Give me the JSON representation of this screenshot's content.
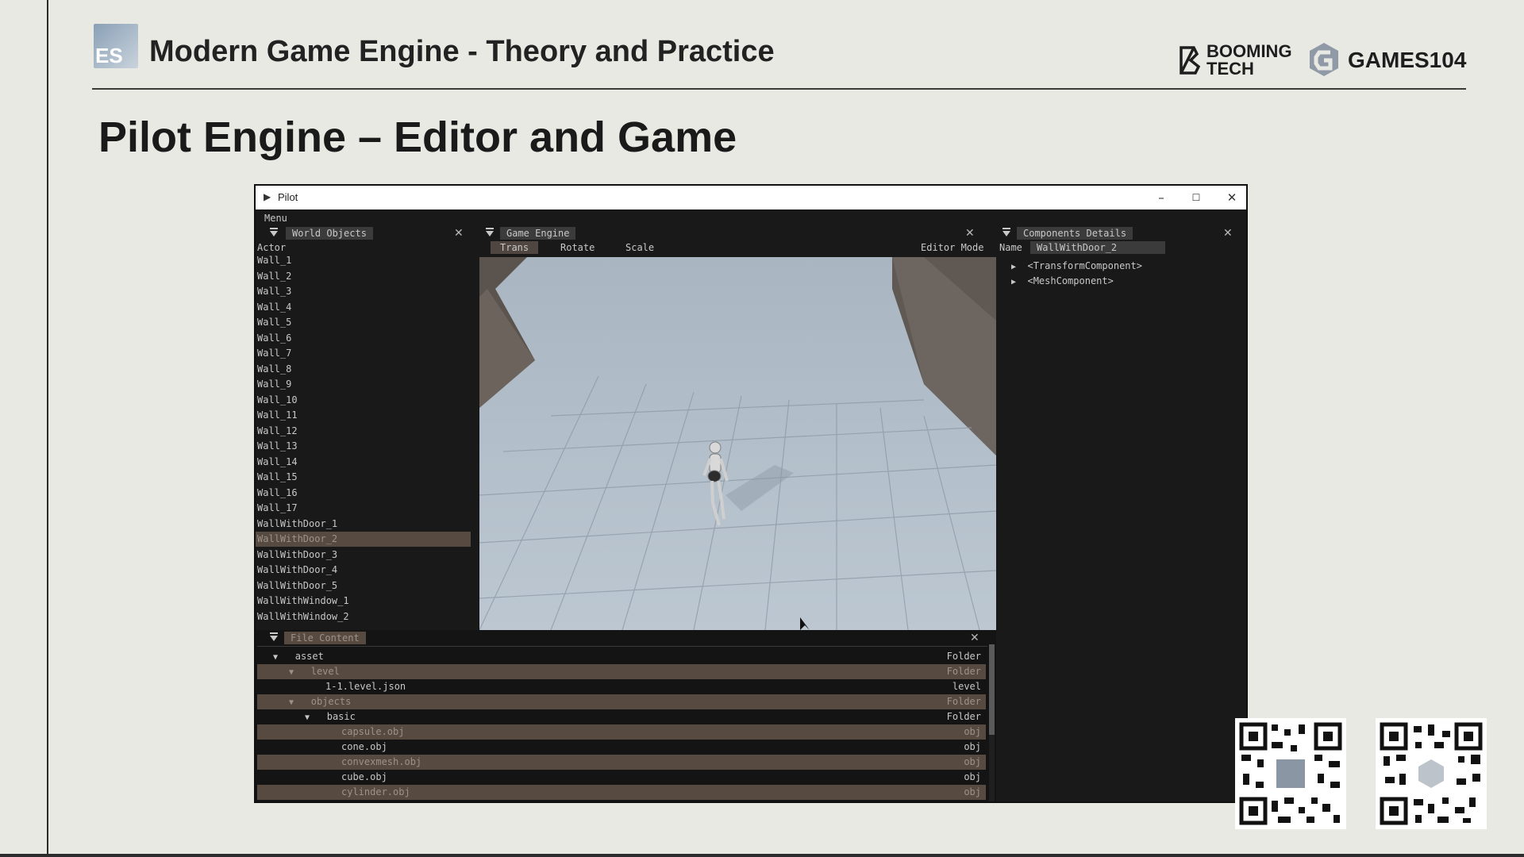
{
  "slide": {
    "course_logo_text": "ES",
    "course_title": "Modern Game Engine - Theory and Practice",
    "title": "Pilot Engine – Editor and Game",
    "logos": {
      "booming_line1": "BOOMING",
      "booming_line2": "TECH",
      "games": "GAMES104"
    }
  },
  "window": {
    "title": "Pilot",
    "controls": {
      "minimize": "–",
      "maximize": "☐",
      "close": "✕"
    },
    "menu": "Menu"
  },
  "world_objects": {
    "tab": "World Objects",
    "header": "Actor",
    "selected_index": 18,
    "items": [
      "Wall_1",
      "Wall_2",
      "Wall_3",
      "Wall_4",
      "Wall_5",
      "Wall_6",
      "Wall_7",
      "Wall_8",
      "Wall_9",
      "Wall_10",
      "Wall_11",
      "Wall_12",
      "Wall_13",
      "Wall_14",
      "Wall_15",
      "Wall_16",
      "Wall_17",
      "WallWithDoor_1",
      "WallWithDoor_2",
      "WallWithDoor_3",
      "WallWithDoor_4",
      "WallWithDoor_5",
      "WallWithWindow_1",
      "WallWithWindow_2"
    ]
  },
  "game_engine": {
    "tab": "Game Engine",
    "tools": [
      "Trans",
      "Rotate",
      "Scale"
    ],
    "active_tool": "Trans",
    "mode_label": "Editor Mode"
  },
  "components": {
    "tab": "Components Details",
    "name_label": "Name",
    "name_value": "WallWithDoor_2",
    "items": [
      "<TransformComponent>",
      "<MeshComponent>"
    ]
  },
  "file_content": {
    "tab": "File Content",
    "rows": [
      {
        "name": "asset",
        "type": "Folder",
        "expanded": true
      },
      {
        "name": "level",
        "type": "Folder",
        "expanded": true
      },
      {
        "name": "1-1.level.json",
        "type": "level"
      },
      {
        "name": "objects",
        "type": "Folder",
        "expanded": true
      },
      {
        "name": "basic",
        "type": "Folder",
        "expanded": true
      },
      {
        "name": "capsule.obj",
        "type": "obj"
      },
      {
        "name": "cone.obj",
        "type": "obj"
      },
      {
        "name": "convexmesh.obj",
        "type": "obj"
      },
      {
        "name": "cube.obj",
        "type": "obj"
      },
      {
        "name": "cylinder.obj",
        "type": "obj"
      }
    ]
  },
  "colors": {
    "selection": "#574a41",
    "panel_bg": "#191919",
    "viewport_sky": "#9aa7b3"
  }
}
